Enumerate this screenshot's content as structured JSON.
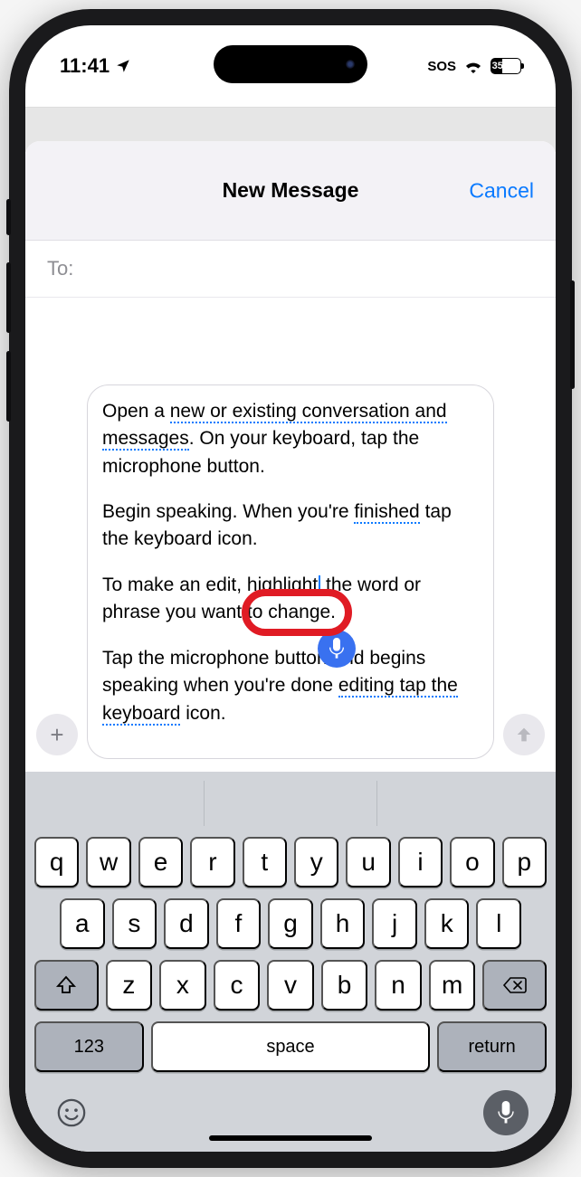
{
  "status_bar": {
    "time": "11:41",
    "sos": "SOS",
    "battery_pct": "35"
  },
  "sheet": {
    "title": "New Message",
    "cancel": "Cancel",
    "to_label": "To:"
  },
  "message": {
    "p1a": "Open a ",
    "p1b": "new or existing conversation and messages",
    "p1c": ". On your keyboard, tap the microphone button.",
    "p2a": "Begin speaking. When you're ",
    "p2b": "finished",
    "p2c": " tap the keyboard icon.",
    "p3a": "To make an edit, ",
    "p3_highlight": "highlight",
    "p3b": " the word or phrase you want to change.",
    "p4a": "Tap the microphone button and begins speaking when you're done ",
    "p4b": "editing tap the keyboard",
    "p4c": " icon."
  },
  "keyboard": {
    "row1": [
      "q",
      "w",
      "e",
      "r",
      "t",
      "y",
      "u",
      "i",
      "o",
      "p"
    ],
    "row2": [
      "a",
      "s",
      "d",
      "f",
      "g",
      "h",
      "j",
      "k",
      "l"
    ],
    "row3": [
      "z",
      "x",
      "c",
      "v",
      "b",
      "n",
      "m"
    ],
    "num": "123",
    "space": "space",
    "ret": "return"
  }
}
